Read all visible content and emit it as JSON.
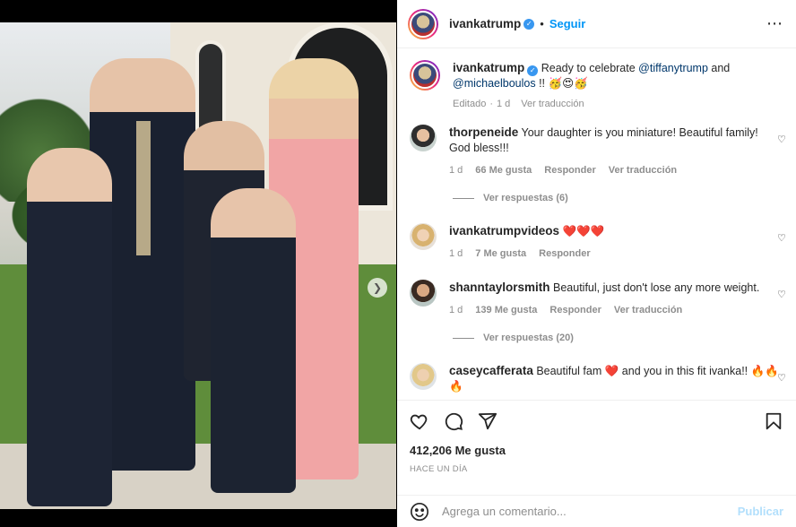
{
  "header": {
    "username": "ivankatrump",
    "separator": "•",
    "follow_label": "Seguir",
    "more_icon": "⋯"
  },
  "caption": {
    "username": "ivankatrump",
    "text_before": " Ready to celebrate ",
    "mention1": "@tiffanytrump",
    "text_mid": " and",
    "mention2": "@michaelboulos",
    "text_after": " !! 🥳😍🥳",
    "edited": "Editado",
    "dot": "·",
    "time": "1 d",
    "translate": "Ver traducción"
  },
  "comments": [
    {
      "username": "thorpeneide",
      "text": "Your daughter is you miniature! Beautiful family! God bless!!!",
      "time": "1 d",
      "likes": "66 Me gusta",
      "reply": "Responder",
      "translate": "Ver traducción",
      "replies": "Ver respuestas (6)"
    },
    {
      "username": "ivankatrumpvideos",
      "text": "❤️❤️❤️",
      "time": "1 d",
      "likes": "7 Me gusta",
      "reply": "Responder"
    },
    {
      "username": "shanntaylorsmith",
      "text": "Beautiful, just don't lose any more weight.",
      "time": "1 d",
      "likes": "139 Me gusta",
      "reply": "Responder",
      "translate": "Ver traducción",
      "replies": "Ver respuestas (20)"
    },
    {
      "username": "caseycafferata",
      "text_before": "Beautiful fam ",
      "heart": "❤️",
      "text_after": " and you in this fit ivanka!! 🔥🔥🔥"
    }
  ],
  "actions": {
    "likes": "412,206 Me gusta",
    "ago": "HACE UN DÍA"
  },
  "compose": {
    "placeholder": "Agrega un comentario...",
    "post_label": "Publicar"
  },
  "colors": {
    "link": "#0095f6",
    "mention": "#00376b",
    "verified": "#3897f0"
  }
}
